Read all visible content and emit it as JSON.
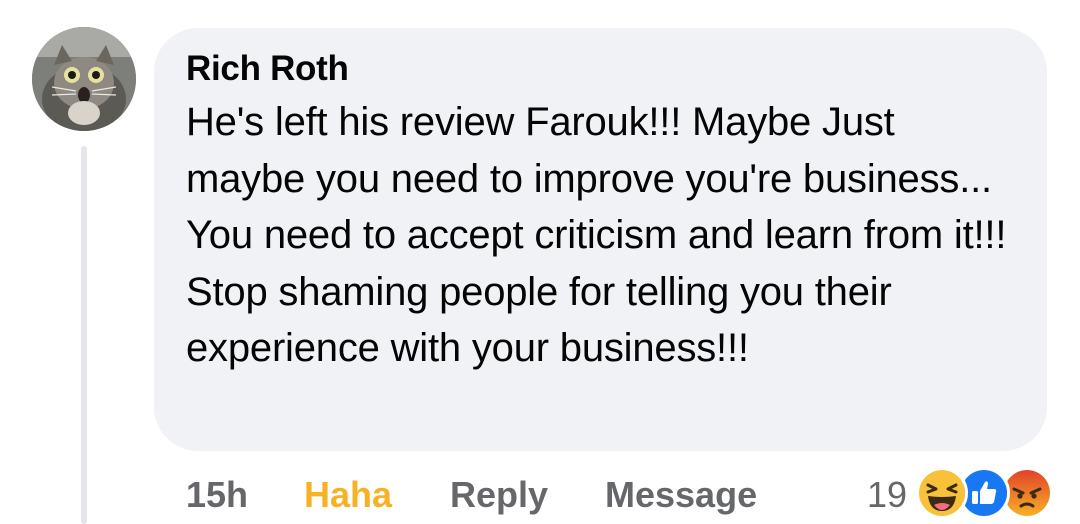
{
  "comment": {
    "author": "Rich Roth",
    "text": "He's left his review Farouk!!! Maybe Just maybe you need to improve you're business... You need to accept criticism and learn from it!!! Stop shaming people for telling you their experience with your business!!!"
  },
  "actions": {
    "timestamp": "15h",
    "reaction_label": "Haha",
    "reply_label": "Reply",
    "message_label": "Message"
  },
  "reactions": {
    "count": "19",
    "icons": [
      "haha-emoji-icon",
      "like-icon",
      "angry-emoji-icon"
    ]
  },
  "colors": {
    "bubble": "#f0f2f5",
    "haha": "#f7b125",
    "secondary_text": "#65676b",
    "like_blue": "#1877f2",
    "angry_red": "#e9710f"
  }
}
